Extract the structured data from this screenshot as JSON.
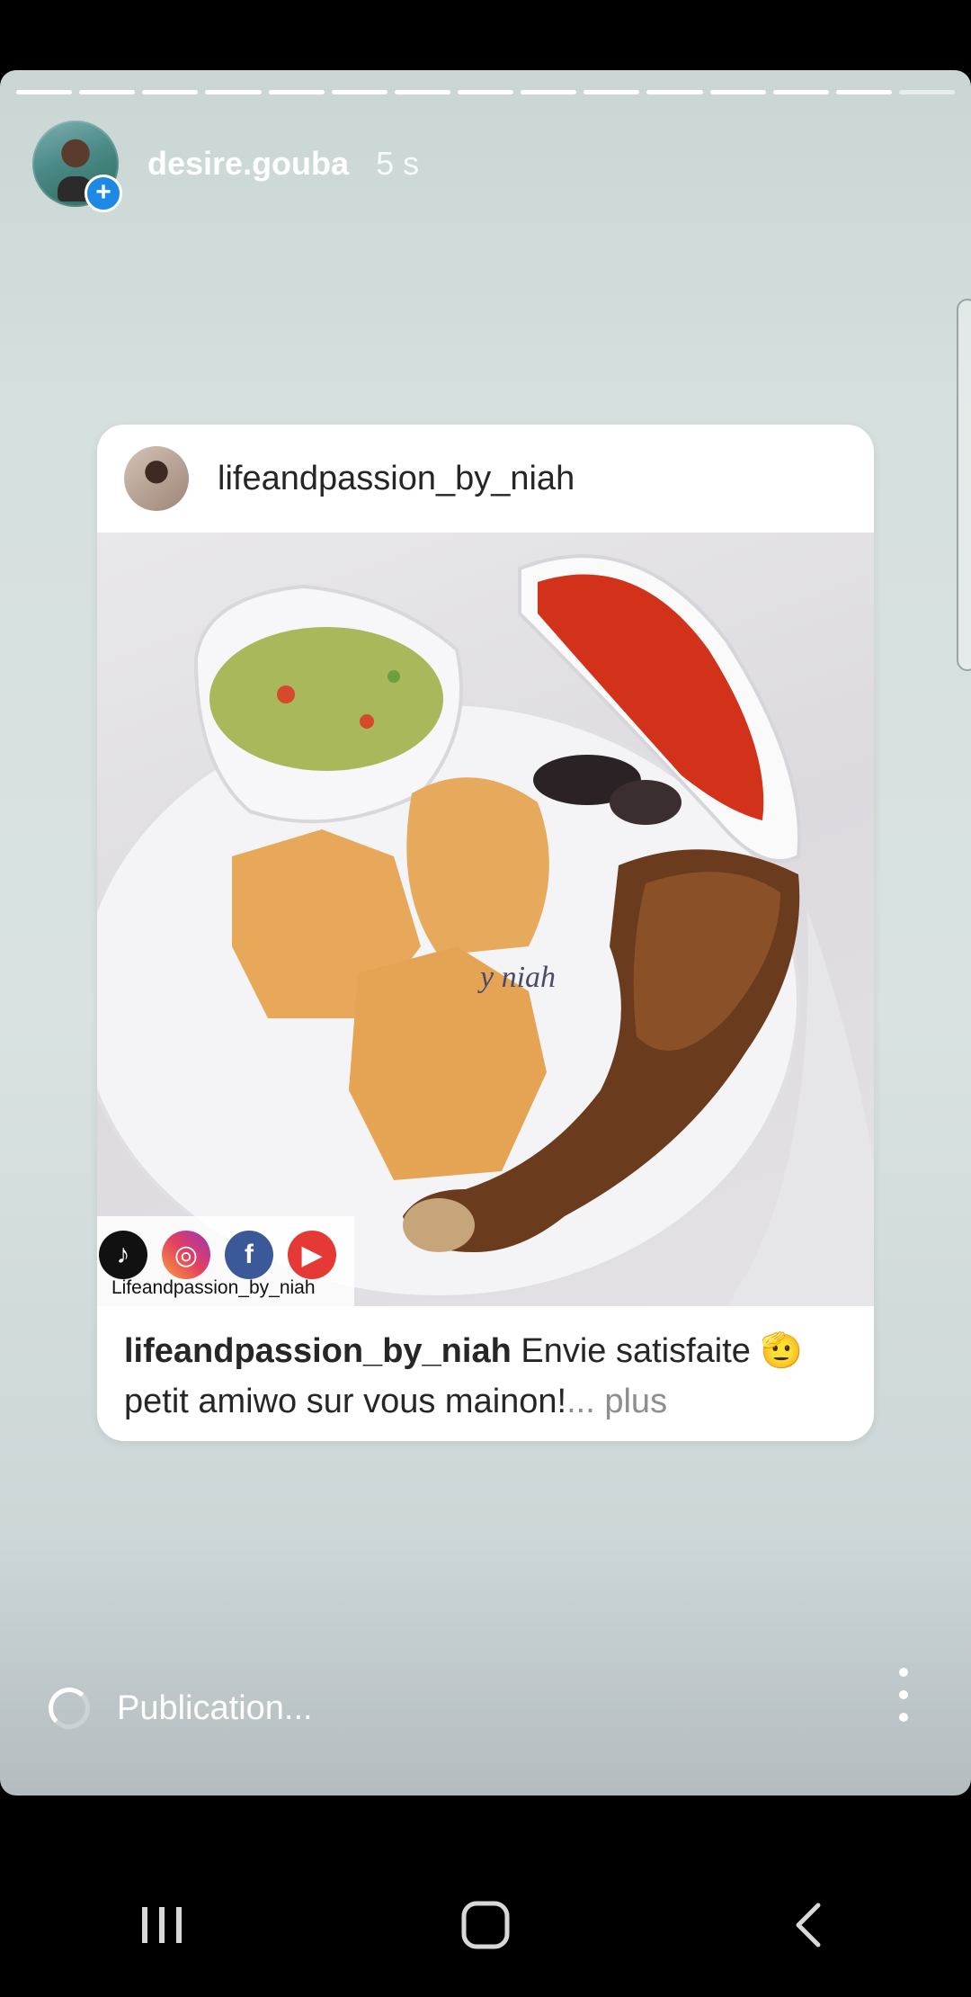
{
  "progress": {
    "segments_total": 15,
    "segments_done": 14
  },
  "story": {
    "username": "desire.gouba",
    "time": "5 s"
  },
  "post": {
    "username": "lifeandpassion_by_niah",
    "image_watermark": "y niah",
    "social_label": "Lifeandpassion_by_niah",
    "caption_user": "lifeandpassion_by_niah",
    "caption_text": "Envie satisfaite 🫡 petit amiwo sur vous mainon!",
    "ellipsis": "...",
    "more_label": "plus"
  },
  "footer": {
    "status": "Publication..."
  },
  "icons": {
    "add_story": "plus-icon",
    "menu": "more-vertical-icon",
    "nav": [
      "recents-icon",
      "home-icon",
      "back-icon"
    ]
  },
  "colors": {
    "accent": "#1e88e5",
    "background": "#000000"
  }
}
